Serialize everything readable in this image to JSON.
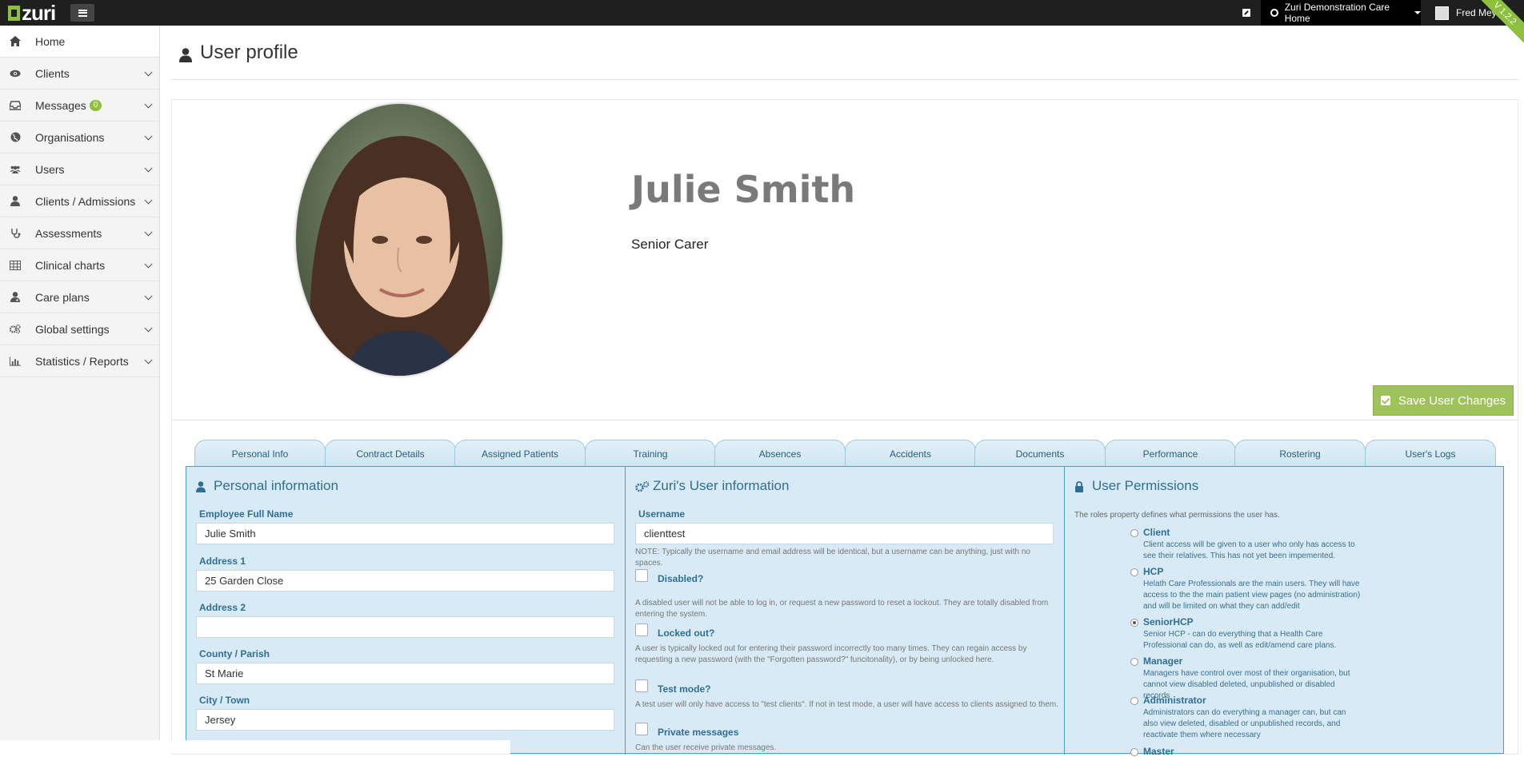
{
  "topbar": {
    "logo_text": "zuri",
    "care_home": "Zuri Demonstration Care Home",
    "user_name": "Fred Meyer",
    "version": "V 1.2.2"
  },
  "sidebar": {
    "items": [
      {
        "label": "Home",
        "icon": "home-icon"
      },
      {
        "label": "Clients",
        "icon": "eye-icon"
      },
      {
        "label": "Messages",
        "icon": "inbox-icon",
        "badge": "0"
      },
      {
        "label": "Organisations",
        "icon": "globe-icon"
      },
      {
        "label": "Users",
        "icon": "users-icon"
      },
      {
        "label": "Clients / Admissions",
        "icon": "user-icon"
      },
      {
        "label": "Assessments",
        "icon": "stethoscope-icon"
      },
      {
        "label": "Clinical charts",
        "icon": "table-icon"
      },
      {
        "label": "Care plans",
        "icon": "user-md-icon"
      },
      {
        "label": "Global settings",
        "icon": "gears-icon"
      },
      {
        "label": "Statistics / Reports",
        "icon": "bar-chart-icon"
      }
    ]
  },
  "page": {
    "title": "User profile"
  },
  "profile": {
    "full_name": "Julie Smith",
    "job_title": "Senior Carer",
    "save_label": "Save User Changes"
  },
  "tabs": [
    "Personal Info",
    "Contract Details",
    "Assigned Patients",
    "Training",
    "Absences",
    "Accidents",
    "Documents",
    "Performance",
    "Rostering",
    "User's Logs"
  ],
  "personal": {
    "title": "Personal information",
    "fields": [
      {
        "label": "Employee Full Name",
        "value": "Julie Smith"
      },
      {
        "label": "Address 1",
        "value": "25 Garden Close"
      },
      {
        "label": "Address 2",
        "value": ""
      },
      {
        "label": "County / Parish",
        "value": "St Marie"
      },
      {
        "label": "City / Town",
        "value": "Jersey"
      }
    ]
  },
  "zuri_info": {
    "title": "Zuri's User information",
    "username_label": "Username",
    "username_value": "clienttest",
    "username_note": "NOTE: Typically the username and email address will be identical, but a username can be anything, just with no spaces.",
    "checks": [
      {
        "label": "Disabled?",
        "note": "A disabled user will not be able to log in, or request a new password to reset a lockout. They are totally disabled from entering the system."
      },
      {
        "label": "Locked out?",
        "note": "A user is typically locked out for entering their password incorrectly too many times. They can regain access by requesting a new password (with the \"Forgotten password?\" funcitonality), or by being unlocked here."
      },
      {
        "label": "Test mode?",
        "note": "A test user will only have access to \"test clients\". If not in test mode, a user will have access to clients assigned to them."
      },
      {
        "label": "Private messages",
        "note": "Can the user receive private messages."
      }
    ]
  },
  "permissions": {
    "title": "User Permissions",
    "intro": "The roles property defines what permissions the user has.",
    "roles": [
      {
        "name": "Client",
        "desc": "Client access will be given to a user who only has access to see their relatives. This has not yet been impemented.",
        "selected": false
      },
      {
        "name": "HCP",
        "desc": "Helath Care Professionals are the main users. They will have access to the the main patient view pages (no administration) and will be limited on what they can add/edit",
        "selected": false
      },
      {
        "name": "SeniorHCP",
        "desc": "Senior HCP - can do everything that a Health Care Professional can do, as well as edit/amend care plans.",
        "selected": true
      },
      {
        "name": "Manager",
        "desc": "Managers have control over most of their organisation, but cannot view disabled deleted, unpublished or disabled records",
        "selected": false
      },
      {
        "name": "Administrator",
        "desc": "Administrators can do everything a manager can, but can also view deleted, disabled or unpublished records, and reactivate them where necessary",
        "selected": false
      },
      {
        "name": "Master",
        "desc": "",
        "selected": false
      }
    ]
  }
}
